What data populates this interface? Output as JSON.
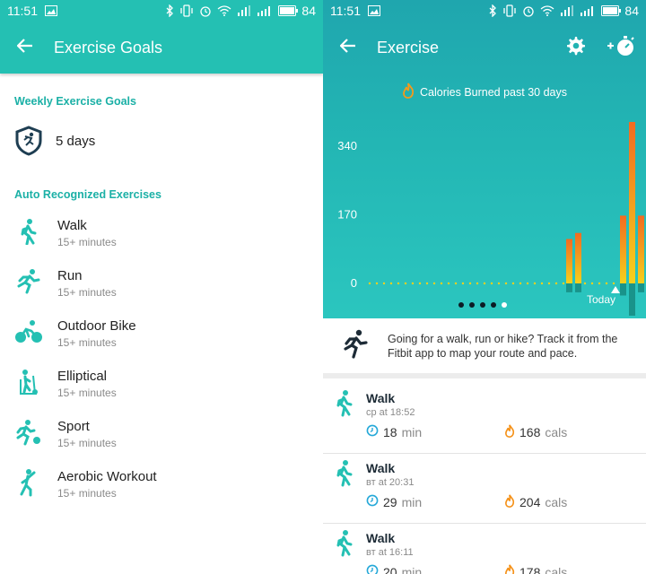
{
  "status_bar": {
    "time": "11:51",
    "battery": "84"
  },
  "exercise_goals_screen": {
    "title": "Exercise Goals",
    "weekly_section_label": "Weekly Exercise Goals",
    "weekly_goal_value": "5 days",
    "auto_section_label": "Auto Recognized Exercises",
    "exercises": [
      {
        "name": "Walk",
        "detail": "15+ minutes",
        "icon": "walk-icon"
      },
      {
        "name": "Run",
        "detail": "15+ minutes",
        "icon": "run-icon"
      },
      {
        "name": "Outdoor Bike",
        "detail": "15+ minutes",
        "icon": "bike-icon"
      },
      {
        "name": "Elliptical",
        "detail": "15+ minutes",
        "icon": "elliptical-icon"
      },
      {
        "name": "Sport",
        "detail": "15+ minutes",
        "icon": "sport-icon"
      },
      {
        "name": "Aerobic Workout",
        "detail": "15+ minutes",
        "icon": "aerobic-icon"
      }
    ]
  },
  "exercise_screen": {
    "title": "Exercise",
    "promo_text": "Going for a walk, run or hike? Track it from the Fitbit app to map your route and pace.",
    "activities": [
      {
        "name": "Walk",
        "when": "ср at 18:52",
        "duration": "18",
        "duration_unit": "min",
        "calories": "168",
        "calories_unit": "cals"
      },
      {
        "name": "Walk",
        "when": "вт at 20:31",
        "duration": "29",
        "duration_unit": "min",
        "calories": "204",
        "calories_unit": "cals"
      },
      {
        "name": "Walk",
        "when": "вт at 16:11",
        "duration": "20",
        "duration_unit": "min",
        "calories": "178",
        "calories_unit": "cals"
      }
    ],
    "colors": {
      "accent": "#24c0b3",
      "bar_top": "#f26b21",
      "bar_bottom": "#f4d11c",
      "below_zero": "#19938a"
    },
    "page_dots": 5,
    "active_page_dot": 4
  },
  "chart_data": {
    "type": "bar",
    "title": "Calories Burned past 30 days",
    "yticks": [
      0,
      170,
      340
    ],
    "ylim": [
      0,
      400
    ],
    "x_last_label": "Today",
    "values": [
      0,
      0,
      0,
      0,
      0,
      0,
      0,
      0,
      0,
      0,
      0,
      0,
      0,
      0,
      0,
      0,
      0,
      0,
      0,
      0,
      0,
      0,
      110,
      125,
      0,
      0,
      0,
      0,
      168,
      400,
      168
    ],
    "below": [
      0,
      0,
      0,
      0,
      0,
      0,
      0,
      0,
      0,
      0,
      0,
      0,
      0,
      0,
      0,
      0,
      0,
      0,
      0,
      0,
      0,
      0,
      22,
      22,
      0,
      0,
      0,
      0,
      30,
      80,
      22
    ]
  }
}
